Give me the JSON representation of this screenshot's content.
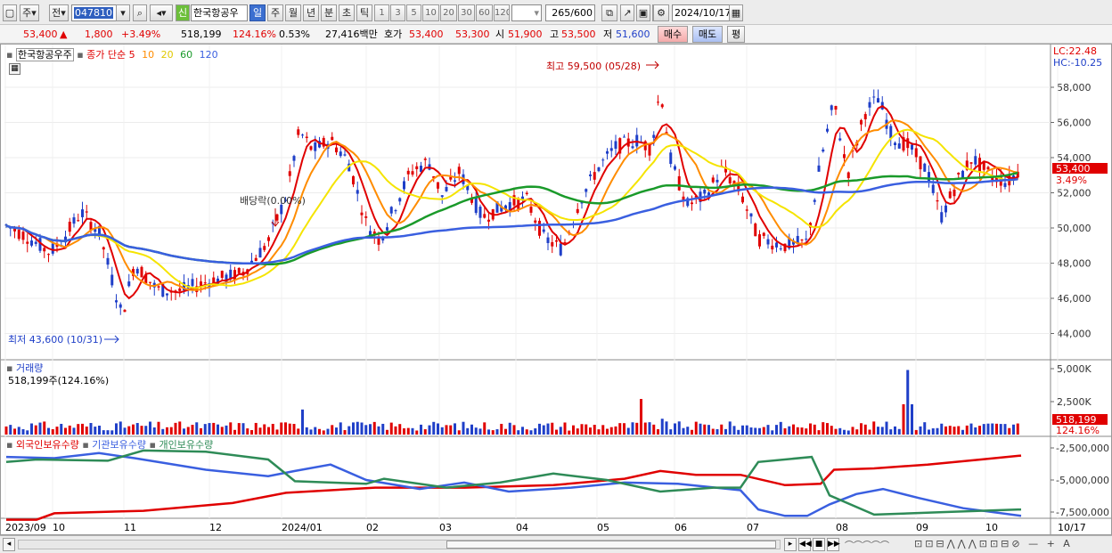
{
  "toolbar": {
    "market_label": "주",
    "period_label": "전",
    "stock_code": "047810",
    "stock_name": "한국항공우",
    "new_badge": "신",
    "period_tabs": [
      "일",
      "주",
      "월",
      "년",
      "분",
      "초",
      "틱"
    ],
    "interval_buttons": [
      "1",
      "3",
      "5",
      "10",
      "20",
      "30",
      "60",
      "120"
    ],
    "count_value": "265",
    "count_total": "/600",
    "date_value": "2024/10/17"
  },
  "quote": {
    "price": "53,400",
    "change": "1,800",
    "change_pct": "+3.49%",
    "volume": "518,199",
    "volume_ratio": "124.16%",
    "turnover": "0.53%",
    "amount": "27,416백만",
    "ask_label": "호가",
    "ask": "53,400",
    "bid": "53,300",
    "open_label": "시",
    "open": "51,900",
    "high_label": "고",
    "high": "53,500",
    "low_label": "저",
    "low": "51,600",
    "buy_button": "매수",
    "sell_button": "매도",
    "eval_button": "평"
  },
  "price_legend": {
    "name": "한국항공우주",
    "ma_label": "종가 단순",
    "ma_periods": [
      "5",
      "10",
      "20",
      "60",
      "120"
    ],
    "lc": "LC:22.48",
    "hc": "HC:-10.25"
  },
  "annotations": {
    "high_mark": "최고 59,500 (05/28)",
    "low_mark": "최저 43,600 (10/31)",
    "dividend": "배당락(0.00%)"
  },
  "price_axis": [
    "58,000",
    "56,000",
    "54,000",
    "52,000",
    "50,000",
    "48,000",
    "46,000",
    "44,000"
  ],
  "price_tag": {
    "price": "53,400",
    "pct": "3.49%"
  },
  "volume_panel": {
    "title": "거래량",
    "value": "518,199주(124.16%)",
    "axis": [
      "5,000K",
      "2,500K"
    ],
    "tag_value": "518,199",
    "tag_pct": "124.16%"
  },
  "holding_panel": {
    "series": [
      "외국인보유수량",
      "기관보유수량",
      "개인보유수량"
    ],
    "axis": [
      "-2,500,000",
      "-5,000,000",
      "-7,500,000"
    ]
  },
  "x_axis": [
    "2023/09",
    "10",
    "11",
    "12",
    "2024/01",
    "02",
    "03",
    "04",
    "05",
    "06",
    "07",
    "08",
    "09",
    "10",
    "10/17"
  ],
  "colors": {
    "up": "#e00000",
    "down": "#1f3fc8",
    "ma5": "#e00000",
    "ma10": "#ff8c00",
    "ma20": "#f5e400",
    "ma60": "#1a9a2a",
    "ma120": "#3a5fe0"
  }
}
